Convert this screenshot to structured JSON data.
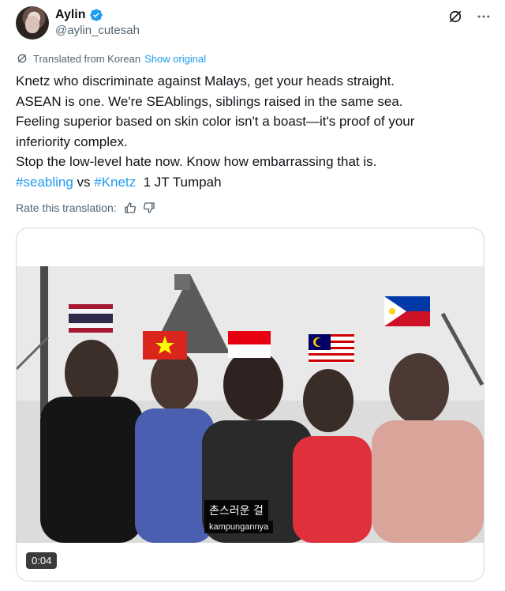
{
  "post": {
    "author": {
      "display_name": "Aylin",
      "handle": "@aylin_cutesah",
      "verified": true
    },
    "translation_notice": "Translated from Korean",
    "show_original_label": "Show original",
    "text_lines": [
      "Knetz who discriminate against Malays, get your heads straight.",
      "ASEAN is one. We're SEAblings, siblings raised in the same sea.",
      "Feeling superior based on skin color isn't a boast—it's proof of your",
      "inferiority complex.",
      "Stop the low-level hate now. Know how embarrassing that is."
    ],
    "hashtag_line": {
      "tag1": "#seabling",
      "vs": " vs ",
      "tag2": "#Knetz",
      "tail": "  1 JT Tumpah"
    },
    "rate_label": "Rate this translation:",
    "video": {
      "time": "0:04",
      "subtitle_ko": "촌스러운 걸",
      "subtitle_en": "kampungannya"
    }
  },
  "colors": {
    "link": "#1d9bf0",
    "secondary_text": "#536471",
    "verified_badge": "#1d9bf0"
  },
  "icons": [
    "verified-badge-icon",
    "grok-icon",
    "more-icon",
    "translate-globe-icon",
    "thumbs-up-icon",
    "thumbs-down-icon"
  ]
}
